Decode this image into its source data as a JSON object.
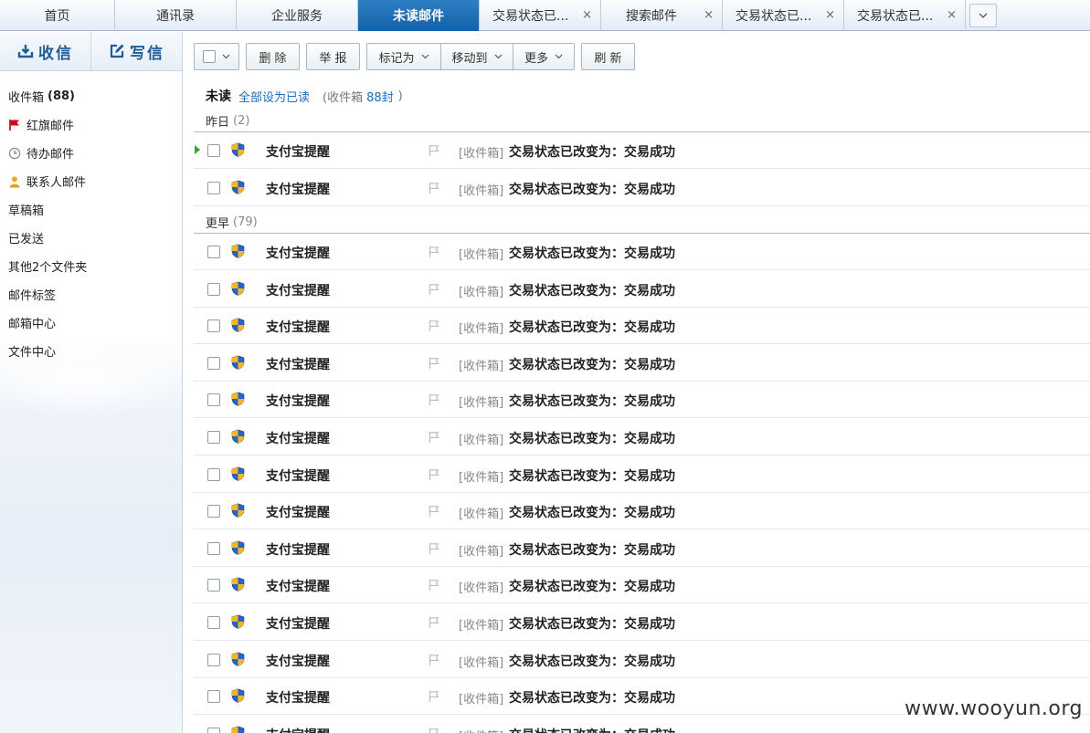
{
  "tabs": [
    {
      "label": "首页",
      "closable": false,
      "active": false
    },
    {
      "label": "通讯录",
      "closable": false,
      "active": false
    },
    {
      "label": "企业服务",
      "closable": false,
      "active": false
    },
    {
      "label": "未读邮件",
      "closable": false,
      "active": true
    },
    {
      "label": "交易状态已...",
      "closable": true,
      "active": false
    },
    {
      "label": "搜索邮件",
      "closable": true,
      "active": false
    },
    {
      "label": "交易状态已...",
      "closable": true,
      "active": false
    },
    {
      "label": "交易状态已...",
      "closable": true,
      "active": false
    }
  ],
  "tab_close_glyph": "×",
  "sidebar": {
    "receive_label": "收信",
    "compose_label": "写信",
    "folders": [
      {
        "label": "收件箱",
        "count": "(88)",
        "icon": ""
      },
      {
        "label": "红旗邮件",
        "count": "",
        "icon": "red-flag-icon"
      },
      {
        "label": "待办邮件",
        "count": "",
        "icon": "clock-icon"
      },
      {
        "label": "联系人邮件",
        "count": "",
        "icon": "contact-icon"
      },
      {
        "label": "草稿箱",
        "count": "",
        "icon": ""
      },
      {
        "label": "已发送",
        "count": "",
        "icon": ""
      },
      {
        "label": "其他2个文件夹",
        "count": "",
        "icon": ""
      },
      {
        "label": "邮件标签",
        "count": "",
        "icon": ""
      },
      {
        "label": "邮箱中心",
        "count": "",
        "icon": ""
      },
      {
        "label": "文件中心",
        "count": "",
        "icon": ""
      }
    ]
  },
  "toolbar": {
    "delete_label": "删 除",
    "report_label": "举 报",
    "mark_label": "标记为",
    "move_label": "移动到",
    "more_label": "更多",
    "refresh_label": "刷 新"
  },
  "summary": {
    "title": "未读",
    "mark_all_read": "全部设为已读",
    "inbox_prefix": "(收件箱",
    "inbox_count": "88封",
    "inbox_suffix": ")"
  },
  "groups": [
    {
      "label": "昨日",
      "count": "(2)"
    },
    {
      "label": "更早",
      "count": "(79)"
    }
  ],
  "mail": {
    "sender": "支付宝提醒",
    "folder_tag": "[收件箱]",
    "subject": "交易状态已改变为：交易成功"
  },
  "colors": {
    "accent": "#1461a8",
    "link": "#1e6bb8",
    "flag": "#d0021b",
    "unread_marker": "#36a336"
  },
  "watermark": "www.wooyun.org"
}
